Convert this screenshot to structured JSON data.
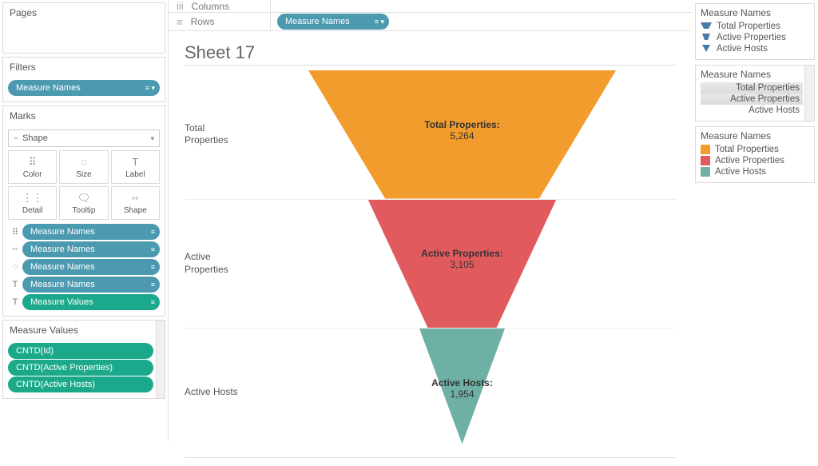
{
  "chart_data": {
    "type": "bar",
    "categories": [
      "Total Properties",
      "Active Properties",
      "Active Hosts"
    ],
    "values": [
      5264,
      3105,
      1954
    ],
    "title": "Sheet 17",
    "xlabel": "",
    "ylabel": "",
    "ylim": [
      0,
      6000
    ],
    "series": [
      {
        "name": "Total Properties",
        "values": [
          5264
        ],
        "color": "#f39c2e"
      },
      {
        "name": "Active Properties",
        "values": [
          3105
        ],
        "color": "#e15b5e"
      },
      {
        "name": "Active Hosts",
        "values": [
          1954
        ],
        "color": "#6eb0a3"
      }
    ]
  },
  "pages": {
    "title": "Pages"
  },
  "filters": {
    "title": "Filters",
    "pill": "Measure Names"
  },
  "marks": {
    "title": "Marks",
    "shape_select": "Shape",
    "btn_color": "Color",
    "btn_size": "Size",
    "btn_label": "Label",
    "btn_detail": "Detail",
    "btn_tooltip": "Tooltip",
    "btn_shape": "Shape",
    "pills": [
      "Measure Names",
      "Measure Names",
      "Measure Names",
      "Measure Names",
      "Measure Values"
    ]
  },
  "measure_values": {
    "title": "Measure Values",
    "pills": [
      "CNTD(Id)",
      "CNTD(Active Properties)",
      "CNTD(Active Hosts)"
    ]
  },
  "shelves": {
    "columns_label": "Columns",
    "rows_label": "Rows",
    "rows_pill": "Measure Names"
  },
  "sheet": {
    "title": "Sheet 17"
  },
  "funnel": {
    "rows": [
      {
        "label": "Total\nProperties",
        "title": "Total Properties:",
        "value": "5,264",
        "color": "#f39c2e"
      },
      {
        "label": "Active\nProperties",
        "title": "Active Properties:",
        "value": "3,105",
        "color": "#e15b5e"
      },
      {
        "label": "Active Hosts",
        "title": "Active Hosts:",
        "value": "1,954",
        "color": "#6eb0a3"
      }
    ]
  },
  "legend_shape": {
    "title": "Measure Names",
    "items": [
      "Total Properties",
      "Active Properties",
      "Active Hosts"
    ]
  },
  "legend_highlight": {
    "title": "Measure Names",
    "items": [
      "Total Properties",
      "Active Properties",
      "Active Hosts"
    ]
  },
  "legend_color": {
    "title": "Measure Names",
    "items": [
      {
        "label": "Total Properties",
        "color": "#f39c2e"
      },
      {
        "label": "Active Properties",
        "color": "#e15b5e"
      },
      {
        "label": "Active Hosts",
        "color": "#6eb0a3"
      }
    ]
  }
}
